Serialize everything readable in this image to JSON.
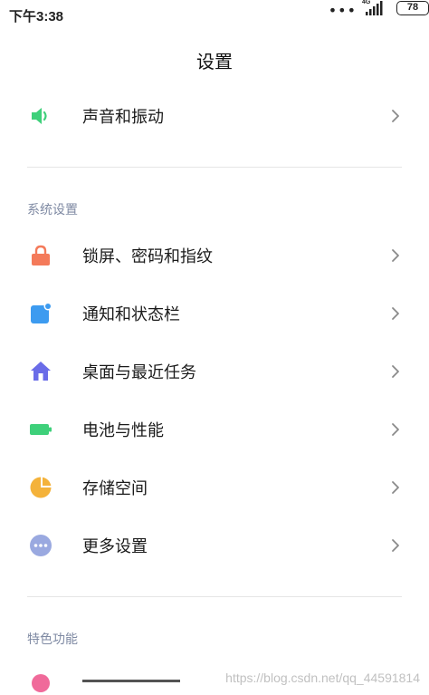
{
  "status_bar": {
    "time": "下午3:38",
    "network": "4G",
    "battery": "78"
  },
  "header": {
    "title": "设置"
  },
  "top_items": [
    {
      "label": "声音和振动",
      "icon": "speaker-icon",
      "color": "#3ed07a"
    }
  ],
  "sections": [
    {
      "header": "系统设置",
      "items": [
        {
          "label": "锁屏、密码和指纹",
          "icon": "lock-icon",
          "color": "#f47a5a"
        },
        {
          "label": "通知和状态栏",
          "icon": "notification-icon",
          "color": "#3d9bf0"
        },
        {
          "label": "桌面与最近任务",
          "icon": "home-icon",
          "color": "#6a6ce8"
        },
        {
          "label": "电池与性能",
          "icon": "battery-icon",
          "color": "#3ed07a"
        },
        {
          "label": "存储空间",
          "icon": "storage-pie-icon",
          "color": "#f4b23a"
        },
        {
          "label": "更多设置",
          "icon": "more-dots-icon",
          "color": "#9aa9e0"
        }
      ]
    },
    {
      "header": "特色功能",
      "items": []
    }
  ],
  "watermark": "https://blog.csdn.net/qq_44591814"
}
